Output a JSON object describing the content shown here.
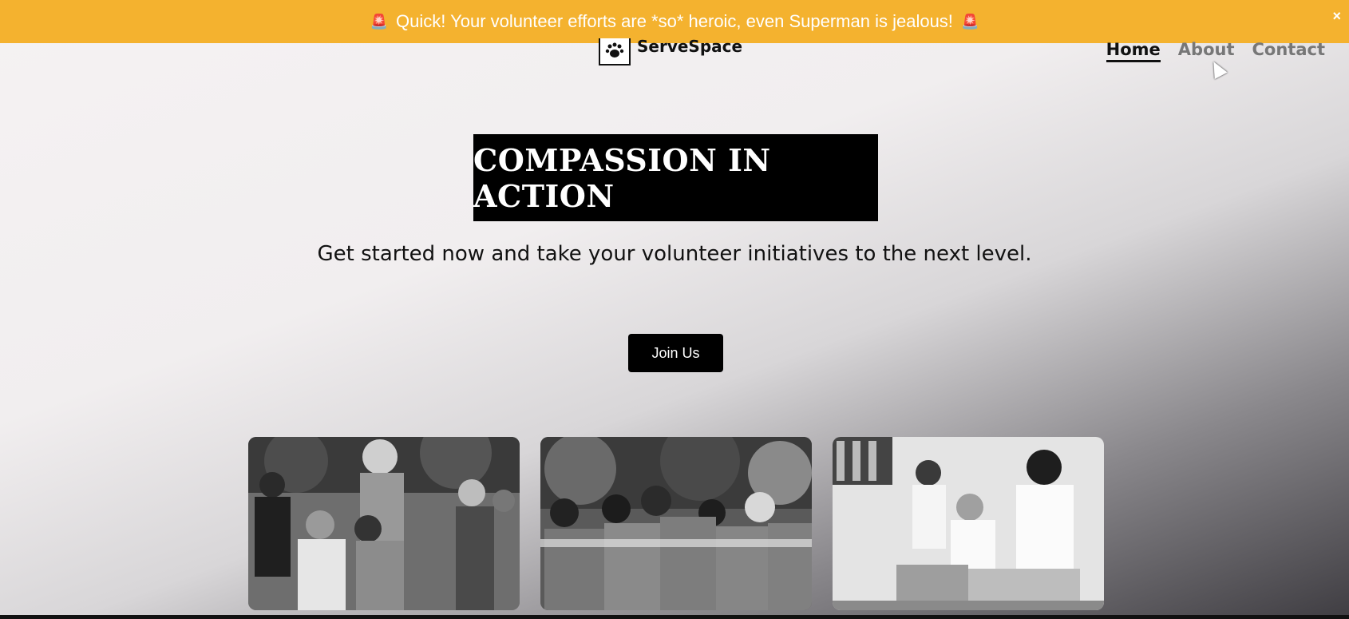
{
  "banner": {
    "text": "Quick! Your volunteer efforts are *so* heroic, even Superman is jealous!",
    "emoji_left": "🚨",
    "emoji_right": "🚨",
    "close": "×",
    "background": "#f4b22f"
  },
  "brand": {
    "name": "ServeSpace",
    "logo_icon": "paw-icon"
  },
  "nav": {
    "items": [
      {
        "label": "Home",
        "active": true
      },
      {
        "label": "About"
      },
      {
        "label": "Contact"
      }
    ]
  },
  "hero": {
    "title": "COMPASSION IN ACTION",
    "subtitle": "Get started now and take your volunteer initiatives to the next level.",
    "cta": "Join Us"
  },
  "cards": [
    {
      "image": "kids-playing-photo"
    },
    {
      "image": "volunteers-group-hug-photo"
    },
    {
      "image": "volunteers-packing-boxes-photo"
    }
  ]
}
